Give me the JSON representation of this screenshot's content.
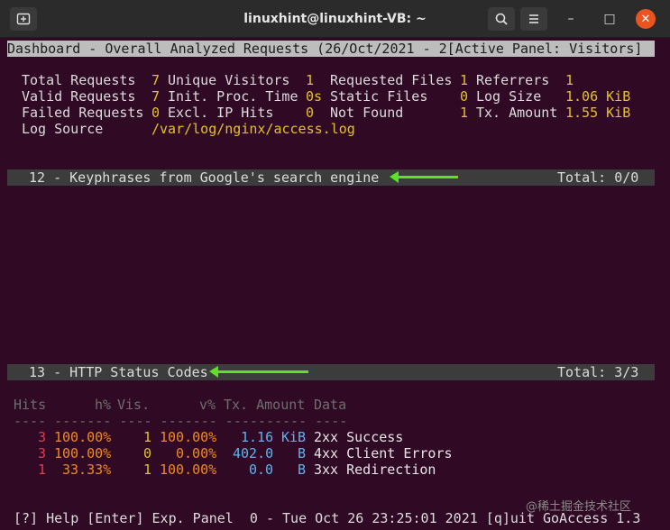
{
  "window": {
    "title": "linuxhint@linuxhint-VB: ~",
    "buttons": {
      "new_tab_icon": "new-tab-icon",
      "search_icon": "search-icon",
      "menu_icon": "hamburger-menu-icon"
    },
    "controls": {
      "minimize": "–",
      "maximize": "□",
      "close": "✕"
    }
  },
  "dashboard": {
    "header": "Dashboard - Overall Analyzed Requests (26/Oct/2021 - 2[Active Panel: Visitors]",
    "stats": [
      [
        {
          "label": "Total Requests",
          "value": "7"
        },
        {
          "label": "Unique Visitors",
          "value": "1"
        },
        {
          "label": "Requested Files",
          "value": "1"
        },
        {
          "label": "Referrers",
          "value": "1"
        }
      ],
      [
        {
          "label": "Valid Requests",
          "value": "7"
        },
        {
          "label": "Init. Proc. Time",
          "value": "0s"
        },
        {
          "label": "Static Files",
          "value": "0"
        },
        {
          "label": "Log Size",
          "value": "1.06 KiB"
        }
      ],
      [
        {
          "label": "Failed Requests",
          "value": "0"
        },
        {
          "label": "Excl. IP Hits",
          "value": "0"
        },
        {
          "label": "Not Found",
          "value": "1"
        },
        {
          "label": "Tx. Amount",
          "value": "1.55 KiB"
        }
      ]
    ],
    "log_source_label": "Log Source",
    "log_source_value": "/var/log/nginx/access.log"
  },
  "panel12": {
    "title": "12 - Keyphrases from Google's search engine",
    "total": "Total: 0/0"
  },
  "panel13": {
    "title": "13 - HTTP Status Codes",
    "total": "Total: 3/3",
    "columns": [
      "Hits",
      "h%",
      "Vis.",
      "v%",
      "Tx. Amount",
      "Data"
    ],
    "separator": "---- ------- ---- ------- ---------- ----",
    "rows": [
      {
        "hits": "3",
        "hp": "100.00%",
        "vis": "1",
        "vp": "100.00%",
        "tx": "1.16",
        "unit": "KiB",
        "data": "2xx Success"
      },
      {
        "hits": "3",
        "hp": "100.00%",
        "vis": "0",
        "vp": "0.00%",
        "tx": "402.0",
        "unit": "B",
        "data": "4xx Client Errors"
      },
      {
        "hits": "1",
        "hp": "33.33%",
        "vis": "1",
        "vp": "100.00%",
        "tx": "0.0",
        "unit": "B",
        "data": "3xx Redirection"
      }
    ]
  },
  "footer": "[?] Help [Enter] Exp. Panel  0 - Tue Oct 26 23:25:01 2021 [q]uit GoAccess 1.3",
  "watermark": "@稀土掘金技术社区"
}
